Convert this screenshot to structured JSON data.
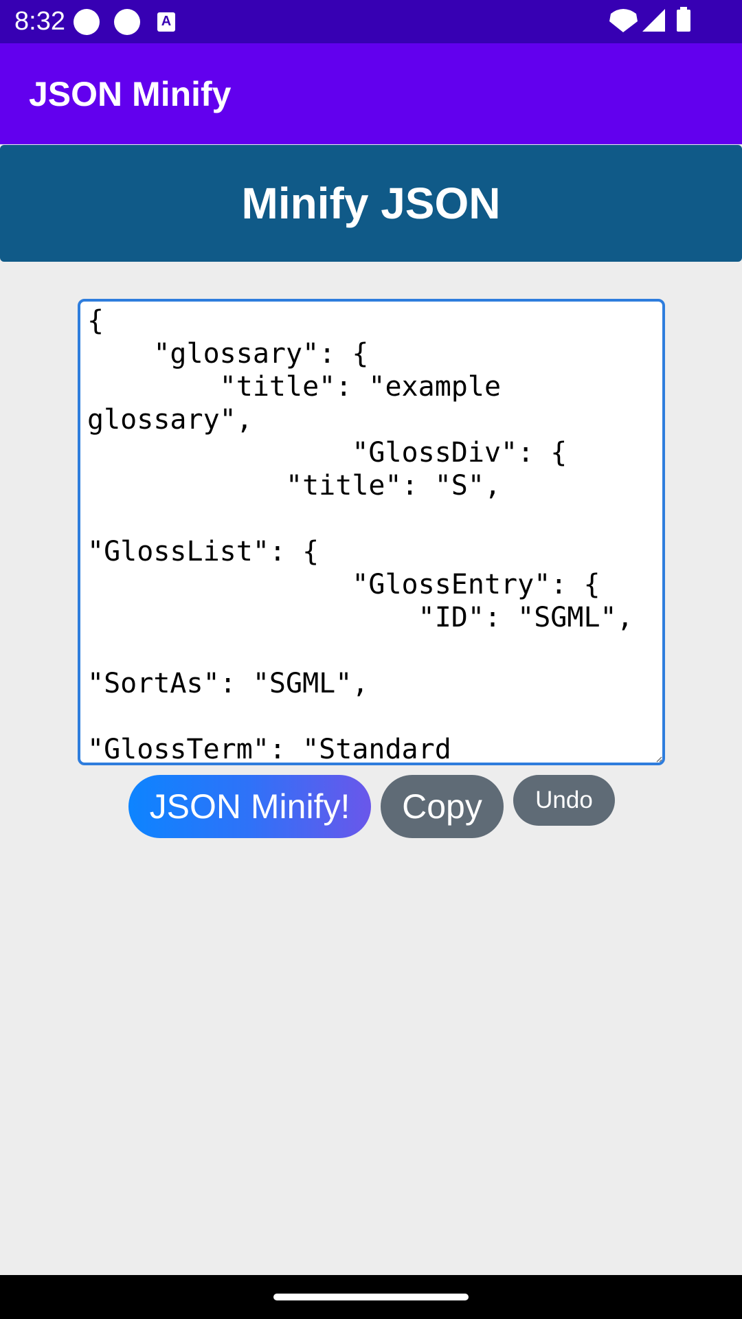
{
  "status_bar": {
    "time": "8:32",
    "icons_left": [
      "circle-notification-icon",
      "circle-notification-icon",
      "text-a-icon"
    ],
    "a_glyph": "A",
    "icons_right": [
      "wifi-icon",
      "cellular-signal-icon",
      "battery-icon"
    ]
  },
  "app_bar": {
    "title": "JSON Minify"
  },
  "banner": {
    "title": "Minify JSON"
  },
  "editor": {
    "value": "{\n    \"glossary\": {\n        \"title\": \"example glossary\",\n                \"GlossDiv\": {\n            \"title\": \"S\",\n                        \"GlossList\": {\n                \"GlossEntry\": {\n                    \"ID\": \"SGML\",\n                                        \"SortAs\": \"SGML\",\n                                        \"GlossTerm\": \"Standard"
  },
  "buttons": {
    "minify_label": "JSON Minify!",
    "copy_label": "Copy",
    "undo_label": "Undo"
  },
  "colors": {
    "status_bar": "#3700b3",
    "app_bar": "#6200ee",
    "banner": "#105a88",
    "background": "#ededed",
    "editor_border": "#2e7ddd",
    "secondary_button": "#5f6b76",
    "minify_gradient_start": "#0d84ff",
    "minify_gradient_end": "#6a57ea"
  }
}
